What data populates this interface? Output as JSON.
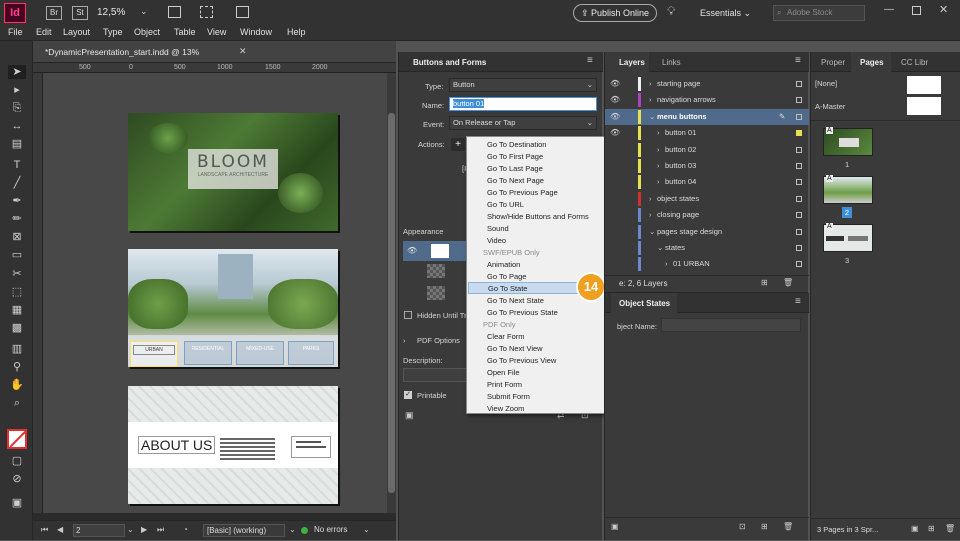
{
  "app": {
    "logo": "Id",
    "bridge": "Br",
    "stock": "St",
    "zoom": "12,5%",
    "publish": "Publish Online",
    "workspace": "Essentials",
    "search_placeholder": "Adobe Stock"
  },
  "menu": [
    "File",
    "Edit",
    "Layout",
    "Type",
    "Object",
    "Table",
    "View",
    "Window",
    "Help"
  ],
  "document": {
    "tab_title": "*DynamicPresentation_start.indd @ 13%",
    "ruler": [
      "500",
      "0",
      "500",
      "1000",
      "1500",
      "2000"
    ],
    "bloom_title": "BLOOM",
    "bloom_subtitle": "LANDSCAPE ARCHITECTURE",
    "nav_buttons": [
      "URBAN",
      "RESIDENTIAL",
      "MIXED-USE",
      "PARKS"
    ],
    "about_title": "ABOUT US"
  },
  "statusbar": {
    "page": "2",
    "style": "[Basic] (working)",
    "errors": "No errors"
  },
  "buttons_forms": {
    "title": "Buttons and Forms",
    "type_label": "Type:",
    "type_value": "Button",
    "name_label": "Name:",
    "name_value": "button 01",
    "event_label": "Event:",
    "event_value": "On Release or Tap",
    "actions_label": "Actions:",
    "appearance": "Appearance",
    "hidden_label": "Hidden Until Tri",
    "pdf_options": "PDF Options",
    "description": "Description:",
    "printable": "Printable",
    "action_partial": "[I"
  },
  "context_menu": {
    "items": [
      "Go To Destination",
      "Go To First Page",
      "Go To Last Page",
      "Go To Next Page",
      "Go To Previous Page",
      "Go To URL",
      "Show/Hide Buttons and Forms",
      "Sound",
      "Video"
    ],
    "swf_header": "SWF/EPUB Only",
    "swf_items": [
      "Animation",
      "Go To Page",
      "Go To State",
      "Go To Next State",
      "Go To Previous State"
    ],
    "pdf_header": "PDF Only",
    "pdf_items": [
      "Clear Form",
      "Go To Next View",
      "Go To Previous View",
      "Open File",
      "Print Form",
      "Submit Form",
      "View Zoom"
    ],
    "highlighted": "Go To State",
    "step_badge": "14"
  },
  "layers": {
    "tab_layers": "Layers",
    "tab_links": "Links",
    "rows": [
      {
        "name": "starting page",
        "color": "#f0f0f0"
      },
      {
        "name": "navigation arrows",
        "color": "#b040c0"
      },
      {
        "name": "menu buttons",
        "color": "#e8e050"
      },
      {
        "name": "button 01",
        "color": "#e8e050"
      },
      {
        "name": "button 02",
        "color": "#e8e050"
      },
      {
        "name": "button 03",
        "color": "#e8e050"
      },
      {
        "name": "button 04",
        "color": "#e8e050"
      },
      {
        "name": "object states",
        "color": "#d03030"
      },
      {
        "name": "closing page",
        "color": "#6a88d0"
      },
      {
        "name": "pages stage design",
        "color": "#6a88d0"
      },
      {
        "name": "states",
        "color": "#6a88d0"
      },
      {
        "name": "01 URBAN",
        "color": "#6a88d0"
      }
    ],
    "footer": "e: 2, 6 Layers"
  },
  "object_states": {
    "title": "Object States",
    "name_label": "bject Name:"
  },
  "pages": {
    "tab_properties": "Proper",
    "tab_pages": "Pages",
    "tab_cc": "CC Libr",
    "none": "[None]",
    "master": "A-Master",
    "page_numbers": [
      "1",
      "2",
      "3"
    ],
    "footer": "3 Pages in 3 Spr..."
  },
  "colors": {
    "accent": "#4a90d9",
    "badge": "#f0a020",
    "highlight": "#3f8fd8"
  }
}
